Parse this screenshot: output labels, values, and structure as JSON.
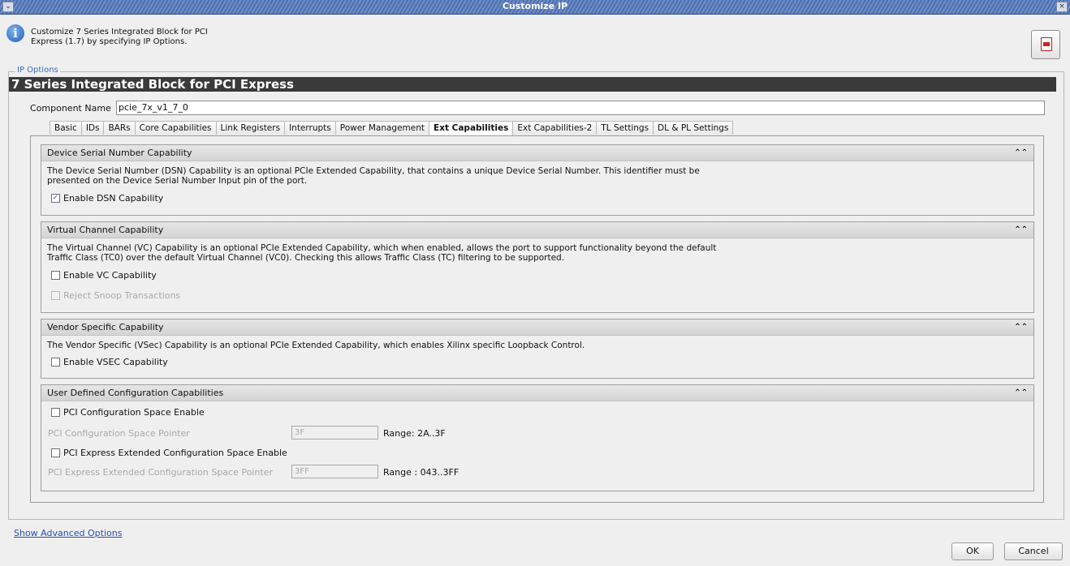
{
  "window": {
    "title": "Customize IP"
  },
  "header": {
    "description": "Customize 7 Series Integrated Block for PCI Express (1.7) by specifying IP Options.",
    "info_icon": "info-icon",
    "doc_icon": "pdf-document-icon"
  },
  "ip_options": {
    "legend": "IP Options",
    "title": "7 Series Integrated Block for PCI Express",
    "component_name_label": "Component Name",
    "component_name_value": "pcie_7x_v1_7_0"
  },
  "tabs": [
    {
      "label": "Basic"
    },
    {
      "label": "IDs"
    },
    {
      "label": "BARs"
    },
    {
      "label": "Core Capabilities"
    },
    {
      "label": "Link Registers"
    },
    {
      "label": "Interrupts"
    },
    {
      "label": "Power Management"
    },
    {
      "label": "Ext Capabilities"
    },
    {
      "label": "Ext Capabilities-2"
    },
    {
      "label": "TL Settings"
    },
    {
      "label": "DL & PL Settings"
    }
  ],
  "active_tab": "Ext Capabilities",
  "panels": {
    "dsn": {
      "title": "Device Serial Number Capability",
      "line1": "The Device Serial Number (DSN) Capability is an optional PCIe Extended Capability, that contains a unique Device Serial Number. This identifier must be",
      "line2": "presented on the Device Serial Number Input pin of the port.",
      "enable_label": "Enable DSN Capability",
      "enable_checked": true
    },
    "vc": {
      "title": "Virtual Channel Capability",
      "line1": "The Virtual Channel (VC) Capability is an optional PCIe Extended Capability, which when enabled, allows the port to support functionality beyond the default",
      "line2": "Traffic Class (TC0) over the default Virtual Channel (VC0). Checking this allows Traffic Class (TC) filtering to be supported.",
      "enable_label": "Enable VC Capability",
      "enable_checked": false,
      "reject_label": "Reject Snoop Transactions",
      "reject_checked": false
    },
    "vsec": {
      "title": "Vendor Specific Capability",
      "line1": "The Vendor Specific (VSec) Capability is an optional PCIe Extended Capability, which enables Xilinx specific Loopback Control.",
      "enable_label": "Enable VSEC Capability",
      "enable_checked": false
    },
    "udc": {
      "title": "User Defined Configuration Capabilities",
      "pci_cfg_enable_label": "PCI Configuration Space Enable",
      "pci_cfg_pointer_label": "PCI Configuration Space Pointer",
      "pci_cfg_pointer_value": "3F",
      "pci_cfg_range": "Range: 2A..3F",
      "pcie_ext_enable_label": "PCI Express Extended Configuration Space Enable",
      "pcie_ext_pointer_label": "PCI Express Extended Configuration Space Pointer",
      "pcie_ext_pointer_value": "3FF",
      "pcie_ext_range": "Range : 043..3FF"
    }
  },
  "footer": {
    "advanced_link": "Show Advanced Options",
    "ok_label": "OK",
    "cancel_label": "Cancel"
  },
  "colors": {
    "titlebar": "#4d6eae",
    "header_band": "#3a3a3a",
    "link": "#2a4cb6",
    "legend": "#3d6bb5"
  }
}
